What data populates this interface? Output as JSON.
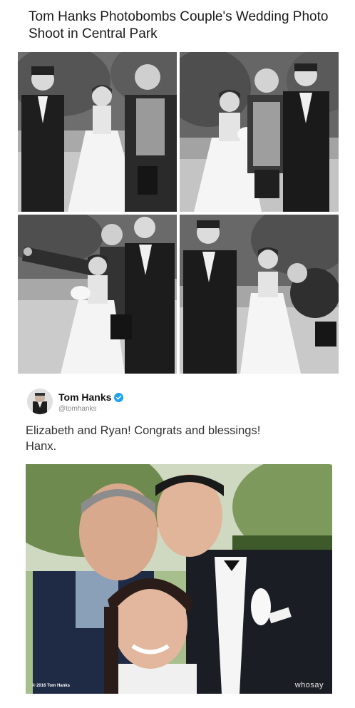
{
  "headline": "Tom Hanks Photobombs Couple's Wedding Photo Shoot in Central Park",
  "tweet": {
    "display_name": "Tom Hanks",
    "handle": "@tomhanks",
    "text_line1": "Elizabeth and Ryan!  Congrats and blessings!",
    "text_line2": "Hanx."
  },
  "photo": {
    "copyright": "© 2016 Tom Hanks",
    "watermark": "whosay"
  },
  "colors": {
    "verified": "#1da1f2",
    "text": "#333333"
  },
  "icons": [
    "verified-icon"
  ]
}
